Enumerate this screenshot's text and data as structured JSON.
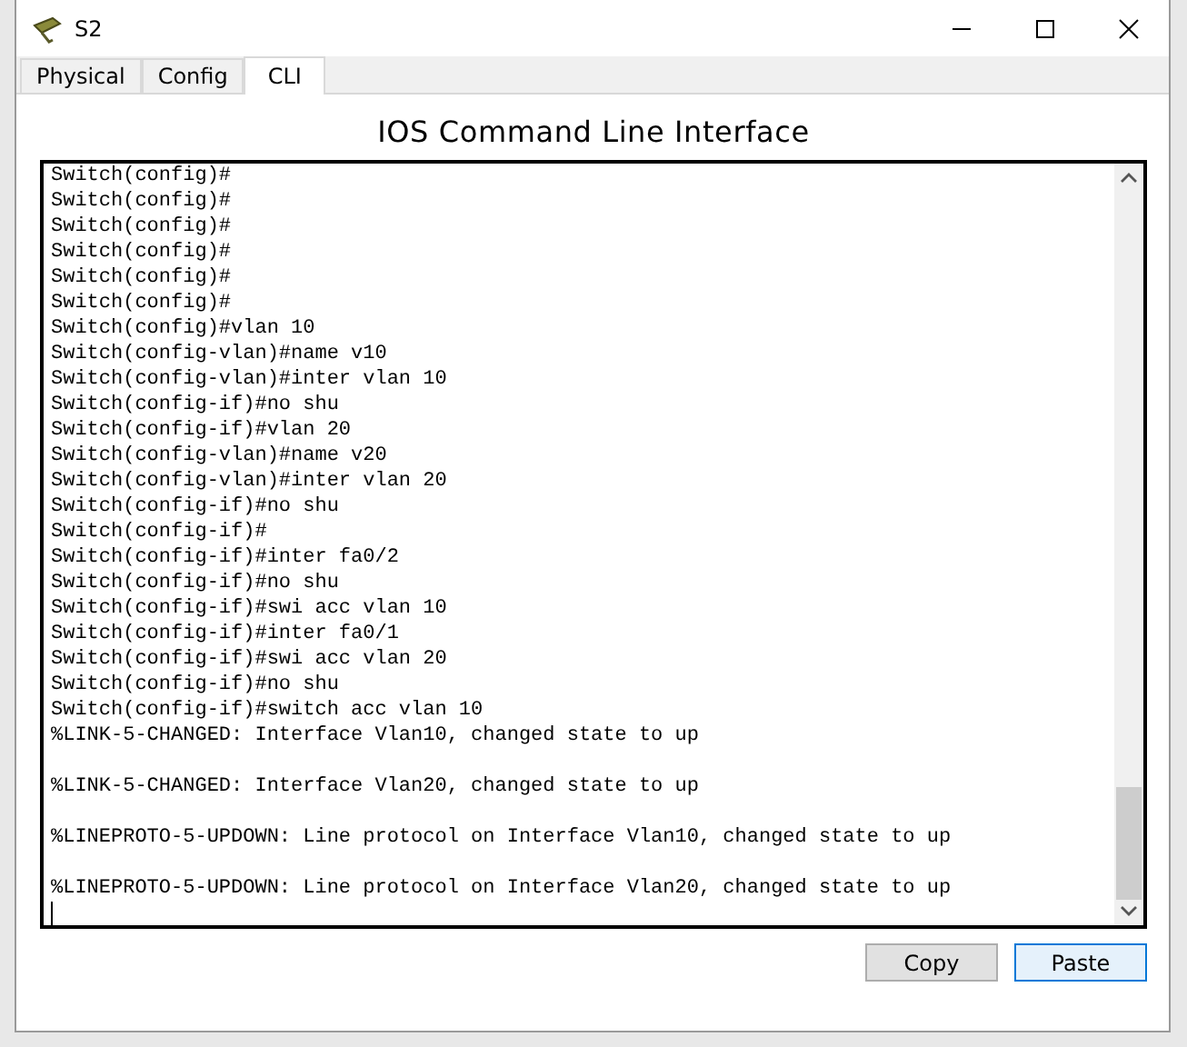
{
  "window": {
    "title": "S2"
  },
  "tabs": [
    {
      "label": "Physical",
      "selected": false
    },
    {
      "label": "Config",
      "selected": false
    },
    {
      "label": "CLI",
      "selected": true
    }
  ],
  "heading": "IOS Command Line Interface",
  "terminal": {
    "lines": [
      {
        "kind": "command",
        "text": "Switch(config)#"
      },
      {
        "kind": "command",
        "text": "Switch(config)#"
      },
      {
        "kind": "command",
        "text": "Switch(config)#"
      },
      {
        "kind": "command",
        "text": "Switch(config)#"
      },
      {
        "kind": "command",
        "text": "Switch(config)#"
      },
      {
        "kind": "command",
        "text": "Switch(config)#"
      },
      {
        "kind": "command",
        "text": "Switch(config)#vlan 10"
      },
      {
        "kind": "command",
        "text": "Switch(config-vlan)#name v10"
      },
      {
        "kind": "command",
        "text": "Switch(config-vlan)#inter vlan 10"
      },
      {
        "kind": "command",
        "text": "Switch(config-if)#no shu"
      },
      {
        "kind": "command",
        "text": "Switch(config-if)#vlan 20"
      },
      {
        "kind": "command",
        "text": "Switch(config-vlan)#name v20"
      },
      {
        "kind": "command",
        "text": "Switch(config-vlan)#inter vlan 20"
      },
      {
        "kind": "command",
        "text": "Switch(config-if)#no shu"
      },
      {
        "kind": "command",
        "text": "Switch(config-if)#"
      },
      {
        "kind": "command",
        "text": "Switch(config-if)#inter fa0/2"
      },
      {
        "kind": "command",
        "text": "Switch(config-if)#no shu"
      },
      {
        "kind": "command",
        "text": "Switch(config-if)#swi acc vlan 10"
      },
      {
        "kind": "command",
        "text": "Switch(config-if)#inter fa0/1"
      },
      {
        "kind": "command",
        "text": "Switch(config-if)#swi acc vlan 20"
      },
      {
        "kind": "command",
        "text": "Switch(config-if)#no shu"
      },
      {
        "kind": "command",
        "text": "Switch(config-if)#switch acc vlan 10"
      },
      {
        "kind": "message",
        "text": "%LINK-5-CHANGED: Interface Vlan10, changed state to up"
      },
      {
        "kind": "message",
        "text": "%LINK-5-CHANGED: Interface Vlan20, changed state to up"
      },
      {
        "kind": "message",
        "text": "%LINEPROTO-5-UPDOWN: Line protocol on Interface Vlan10, changed state to up"
      },
      {
        "kind": "message",
        "text": "%LINEPROTO-5-UPDOWN: Line protocol on Interface Vlan20, changed state to up"
      }
    ]
  },
  "buttons": [
    {
      "label": "Copy",
      "focused": false
    },
    {
      "label": "Paste",
      "focused": true
    }
  ]
}
